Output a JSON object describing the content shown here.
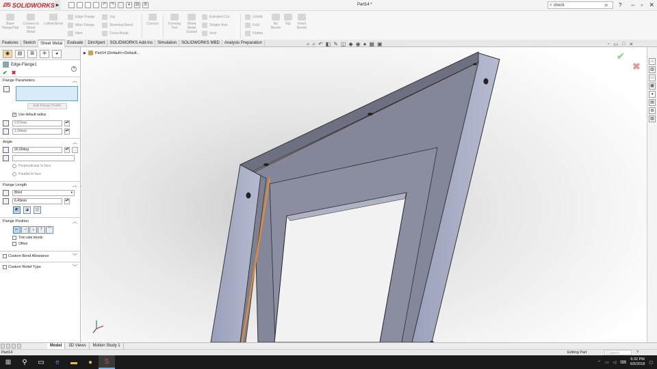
{
  "app": {
    "brand": "SOLIDWORKS",
    "doc_title": "Part14 *"
  },
  "search": {
    "value": "check"
  },
  "commands": {
    "col1": [
      {
        "label": "Base Flange/Tab"
      },
      {
        "label": "Convert to Sheet Metal"
      },
      {
        "label": "Lofted-Bend"
      }
    ],
    "group_a": [
      "Edge Flange",
      "Miter Flange",
      "Hem"
    ],
    "group_b": [
      "Jog",
      "Sketched Bend",
      "Cross-Break"
    ],
    "col2": [
      {
        "label": "Corners"
      }
    ],
    "col3": [
      {
        "label": "Forming Tool"
      },
      {
        "label": "Sheet Metal Gusset"
      }
    ],
    "group_c": [
      "Extruded Cut",
      "Simple Hole",
      "Vent"
    ],
    "group_d": [
      "Unfold",
      "Fold",
      "Flatten"
    ],
    "col4": [
      {
        "label": "No Bends"
      },
      {
        "label": "Rip"
      },
      {
        "label": "Insert Bends"
      }
    ]
  },
  "tabs": [
    "Features",
    "Sketch",
    "Sheet Metal",
    "Evaluate",
    "DimXpert",
    "SOLIDWORKS Add-Ins",
    "Simulation",
    "SOLIDWORKS MBD",
    "Analysis Preparation"
  ],
  "active_tab": "Sheet Metal",
  "property_manager": {
    "title": "Edge-Flange1",
    "sections": {
      "flange_parameters": "Flange Parameters",
      "edit_profile": "Edit Flange Profile",
      "use_default_radius": "Use default radius",
      "radius": "2.67mm",
      "thickness": "1.00mm",
      "angle": "Angle",
      "angle_value": "90.00deg",
      "perpendicular": "Perpendicular to face",
      "parallel": "Parallel to face",
      "flange_length": "Flange Length",
      "length_type": "Blind",
      "length_value": "6.49mm",
      "flange_position": "Flange Position",
      "trim_side_bends": "Trim side bends",
      "offset": "Offset",
      "custom_bend": "Custom Bend Allowance",
      "custom_relief": "Custom Relief Type"
    }
  },
  "viewport": {
    "tree_label": "Part14 (Default<<Default..."
  },
  "bottom_tabs": [
    "Model",
    "3D Views",
    "Motion Study 1"
  ],
  "status": {
    "left": "Part14",
    "mode": "Editing Part",
    "units": "Custom",
    "help": "?"
  },
  "clock": {
    "time": "6:32 PM",
    "date": "6/5/2018"
  },
  "colors": {
    "selection_edge": "#f28c1e",
    "part_face": "#a4a8c0",
    "accent": "#d0202e"
  }
}
